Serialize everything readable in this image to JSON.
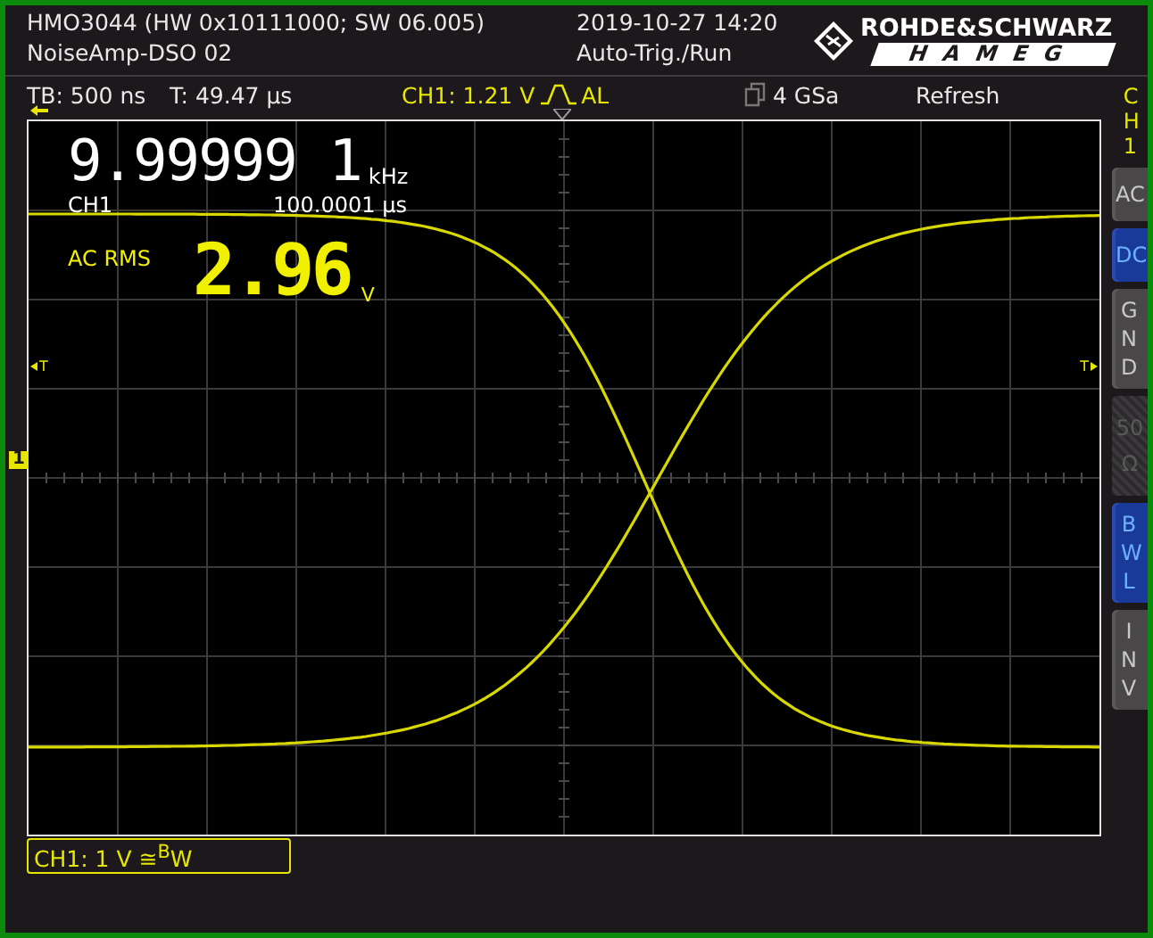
{
  "header": {
    "instrument": "HMO3044 (HW 0x10111000; SW 06.005)",
    "setup": "NoiseAmp-DSO 02",
    "datetime": "2019-10-27 14:20",
    "trigger_state": "Auto-Trig./Run",
    "logo": {
      "top": "ROHDE&SCHWARZ",
      "bottom": "HAMEG"
    }
  },
  "status": {
    "timebase": "TB: 500 ns",
    "trigger_time": "T: 49.47 µs",
    "trigger_source": "CH1: 1.21 V",
    "trigger_mode": "AL",
    "sample_rate": "4 GSa",
    "acquisition": "Refresh"
  },
  "measurements": {
    "frequency": {
      "value": "9.99999 1",
      "unit": "kHz",
      "source": "CH1",
      "period": "100.0001 µs"
    },
    "rms": {
      "label": "AC RMS",
      "value": "2.96",
      "unit": "V"
    }
  },
  "markers": {
    "trigger_level_left": "T",
    "trigger_level_right": "T",
    "channel": "1"
  },
  "channel_menu": {
    "title": "CH1",
    "buttons": [
      {
        "label": "AC",
        "kind": "row",
        "selected": false,
        "disabled": false
      },
      {
        "label": "DC",
        "kind": "row",
        "selected": true,
        "disabled": false
      },
      {
        "label": "GND",
        "kind": "column",
        "selected": false,
        "disabled": false
      },
      {
        "label": "50 Ω",
        "kind": "stack",
        "selected": false,
        "disabled": true
      },
      {
        "label": "BWL",
        "kind": "column",
        "selected": true,
        "disabled": false
      },
      {
        "label": "INV",
        "kind": "column",
        "selected": false,
        "disabled": false
      }
    ]
  },
  "footer": {
    "channel_info": "CH1: 1 V ≅$^{B}$W"
  }
}
